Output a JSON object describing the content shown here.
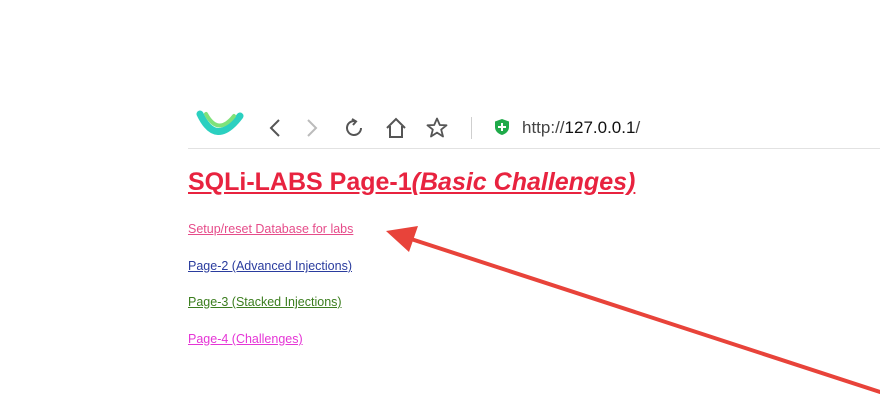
{
  "browser": {
    "url_scheme": "http://",
    "url_host": "127.0.0.1",
    "url_tail": "/",
    "icons": [
      "browser-logo-icon",
      "back-icon",
      "forward-icon",
      "reload-icon",
      "home-icon",
      "bookmark-star-icon",
      "secure-shield-icon"
    ]
  },
  "page": {
    "title_main": "SQLi-LABS Page-1",
    "title_sub": "(Basic Challenges)",
    "links": [
      {
        "label": "Setup/reset Database for labs",
        "color": "#e64c8a"
      },
      {
        "label": "Page-2 (Advanced Injections)",
        "color": "#2a3c9e"
      },
      {
        "label": "Page-3 (Stacked Injections)",
        "color": "#3b7d1e"
      },
      {
        "label": "Page-4 (Challenges)",
        "color": "#e535d6"
      }
    ]
  },
  "annotation": {
    "arrow_color": "#e8433a"
  }
}
